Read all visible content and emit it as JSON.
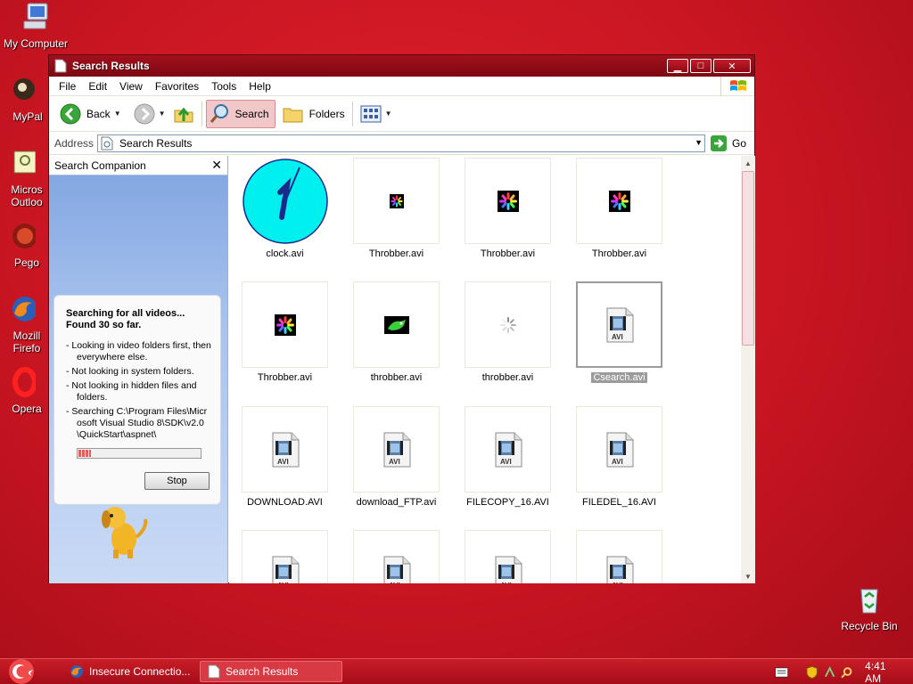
{
  "desktop": {
    "icons": [
      {
        "label": "My Computer",
        "icon": "my-computer-icon"
      },
      {
        "label": "MyPal",
        "icon": "mypal-icon"
      },
      {
        "label": "Micros\nOutloo",
        "icon": "outlook-icon"
      },
      {
        "label": "Pego",
        "icon": "pegasus-icon"
      },
      {
        "label": "Mozill\nFirefo",
        "icon": "firefox-icon"
      },
      {
        "label": "Opera",
        "icon": "opera-icon"
      },
      {
        "label": "Recycle Bin",
        "icon": "recycle-bin-icon"
      }
    ]
  },
  "window": {
    "title": "Search Results",
    "menu": [
      "File",
      "Edit",
      "View",
      "Favorites",
      "Tools",
      "Help"
    ],
    "toolbar": {
      "back": "Back",
      "search": "Search",
      "folders": "Folders"
    },
    "address": {
      "label": "Address",
      "value": "Search Results",
      "go": "Go"
    }
  },
  "companion": {
    "title": "Search Companion",
    "heading": "Searching for all videos...\nFound 30 so far.",
    "bullets": [
      "- Looking in video folders first, then everywhere else.",
      "- Not looking in system folders.",
      "- Not looking in hidden files and folders.",
      "- Searching C:\\Program Files\\Microsoft Visual Studio 8\\SDK\\v2.0\\QuickStart\\aspnet\\"
    ],
    "progress": 0.1,
    "stop_label": "Stop"
  },
  "files": [
    {
      "name": "clock.avi",
      "thumb": "clock"
    },
    {
      "name": "Throbber.avi",
      "thumb": "throbber-small"
    },
    {
      "name": "Throbber.avi",
      "thumb": "throbber"
    },
    {
      "name": "Throbber.avi",
      "thumb": "throbber"
    },
    {
      "name": "Throbber.avi",
      "thumb": "throbber"
    },
    {
      "name": "throbber.avi",
      "thumb": "green"
    },
    {
      "name": "throbber.avi",
      "thumb": "spinner"
    },
    {
      "name": "Csearch.avi",
      "thumb": "avi",
      "selected": true
    },
    {
      "name": "DOWNLOAD.AVI",
      "thumb": "avi"
    },
    {
      "name": "download_FTP.avi",
      "thumb": "avi"
    },
    {
      "name": "FILECOPY_16.AVI",
      "thumb": "avi"
    },
    {
      "name": "FILEDEL_16.AVI",
      "thumb": "avi"
    },
    {
      "name": "",
      "thumb": "avi"
    },
    {
      "name": "",
      "thumb": "avi"
    },
    {
      "name": "",
      "thumb": "avi"
    },
    {
      "name": "",
      "thumb": "avi"
    }
  ],
  "taskbar": {
    "tasks": [
      {
        "label": "Insecure Connectio..."
      },
      {
        "label": "Search Results"
      }
    ],
    "clock": "4:41 AM"
  },
  "colors": {
    "desktop": "#c81522",
    "titlebar": "#8e0813",
    "selection": "#9b9b9b"
  }
}
